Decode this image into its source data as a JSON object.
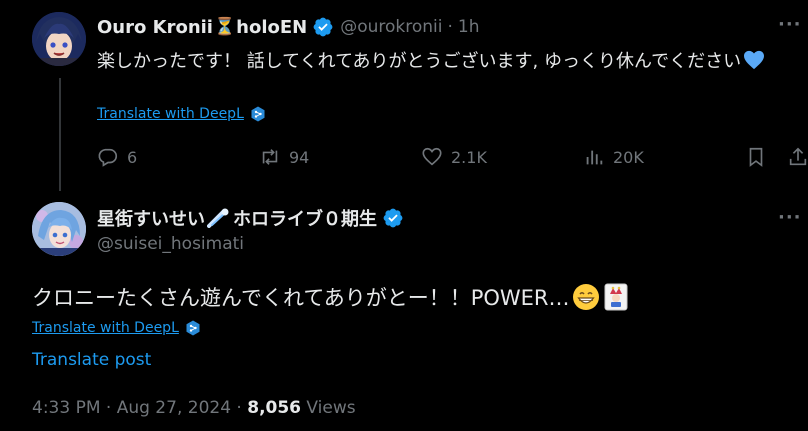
{
  "reply_tweet": {
    "display_name": "Ouro Kronii",
    "name_suffix": "holoEN",
    "hourglass": "⏳",
    "handle": "@ourokronii",
    "separator": "·",
    "time": "1h",
    "more": "···",
    "text": "楽しかったです！ 話してくれてありがとうございます, ゆっくり休んでください",
    "translate_label": "Translate with DeepL",
    "actions": {
      "replies": "6",
      "reposts": "94",
      "likes": "2.1K",
      "views": "20K"
    }
  },
  "main_tweet": {
    "display_name": "星街すいせい",
    "name_suffix": "ホロライブ０期生",
    "handle": "@suisei_hosimati",
    "more": "···",
    "text": "クロニーたくさん遊んでくれてありがとー！！POWER…",
    "translate_label": "Translate with DeepL",
    "translate_post": "Translate post",
    "timestamp": "4:33 PM · Aug 27, 2024",
    "meta_separator": "·",
    "views_count": "8,056",
    "views_label": "Views"
  },
  "colors": {
    "background": "#000000",
    "text_primary": "#e7e9ea",
    "text_secondary": "#71767b",
    "accent": "#1d9bf0",
    "verified": "#1d9bf0",
    "heart": "#5aa9f7"
  }
}
